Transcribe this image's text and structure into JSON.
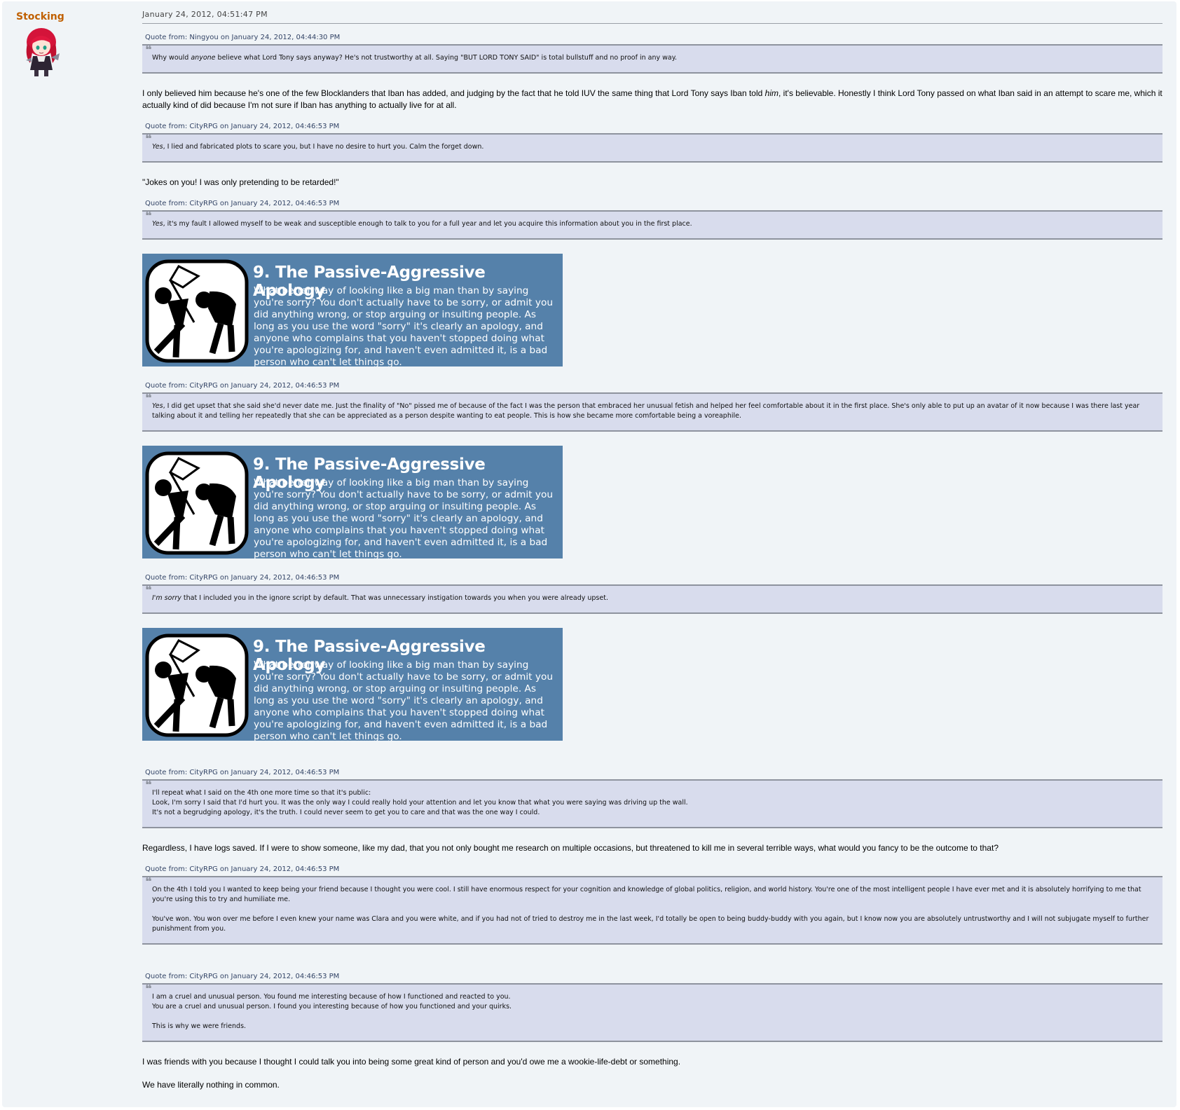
{
  "poster": {
    "name": "Stocking",
    "avatar_icon": "anime-girl-avatar-icon"
  },
  "post": {
    "date": "January 24, 2012, 04:51:47 PM"
  },
  "meme": {
    "icon": "kicking-stickfigure-icon",
    "title": "9. The Passive-Aggressive Apology",
    "body": "What better way of looking like a big man than by saying you're sorry?  You don't actually have to be sorry, or admit you did anything wrong, or stop arguing or insulting people.  As long as you use the word \"sorry\" it's clearly an apology, and anyone who complains that you haven't stopped doing what you're apologizing for, and haven't even admitted it, is a bad person who can't let things go."
  },
  "blocks": {
    "q1": {
      "header": "Quote from: Ningyou on January 24, 2012, 04:44:30 PM",
      "pre": "Why would ",
      "em": "anyone",
      "post": " believe what Lord Tony says anyway? He's not trustworthy at all. Saying \"BUT LORD TONY SAID\" is total bullstuff and no proof in any way."
    },
    "t1": {
      "pre": "I only believed him because he's one of the few Blocklanders that Iban has added, and judging by the fact that he told IUV the same thing that Lord Tony says Iban told ",
      "em": "him",
      "post": ", it's believable. Honestly I think Lord Tony passed on what Iban said in an attempt to scare me, which it actually kind of did because I'm not sure if Iban has anything to actually live for at all."
    },
    "q2": {
      "header": "Quote from: CityRPG on January 24, 2012, 04:46:53 PM",
      "em": "Yes",
      "post": ", I lied and fabricated plots to scare you, but I have no desire to hurt you. Calm the forget down."
    },
    "t2": "\"Jokes on you! I was only pretending to be retarded!\"",
    "q3": {
      "header": "Quote from: CityRPG on January 24, 2012, 04:46:53 PM",
      "em": "Yes",
      "post": ", it's my fault I allowed myself to be weak and susceptible enough to talk to you for a full year and let you acquire this information about you in the first place."
    },
    "q4": {
      "header": "Quote from: CityRPG on January 24, 2012, 04:46:53 PM",
      "em": "Yes",
      "post": ", I did get upset that she said she'd never date me. Just the finality of \"No\" pissed me of because of the fact I was the person that embraced her unusual fetish and helped her feel comfortable about it in the first place. She's only able to put up an avatar of it now because I was there last year talking about it and telling her repeatedly that she can be appreciated as a person despite wanting to eat people. This is how she became more comfortable being a voreaphile."
    },
    "q5": {
      "header": "Quote from: CityRPG on January 24, 2012, 04:46:53 PM",
      "em": "I'm sorry",
      "post": " that I included you in the ignore script by default. That was unnecessary instigation towards you when you were already upset."
    },
    "q6": {
      "header": "Quote from: CityRPG on January 24, 2012, 04:46:53 PM",
      "l1": "I'll repeat what I said on the 4th one more time so that it's public:",
      "l2": "Look, I'm sorry I said that I'd hurt you. It was the only way I could really hold your attention and let you know that what you were saying was driving up the wall.",
      "l3": "It's not a begrudging apology, it's the truth. I could never seem to get you to care and that was the one way I could."
    },
    "t3": "Regardless, I have logs saved. If I were to show someone, like my dad, that you not only bought me research on multiple occasions, but threatened to kill me in several terrible ways, what would you fancy to be the outcome to that?",
    "q7": {
      "header": "Quote from: CityRPG on January 24, 2012, 04:46:53 PM",
      "p1": "On the 4th I told you I wanted to keep being your friend because I thought you were cool. I still have enormous respect for your cognition and knowledge of global politics, religion, and world history. You're one of the most intelligent people I have ever met and it is absolutely horrifying to me that you're using this to try and humiliate me.",
      "p2": "You've won. You won over me before I even knew your name was Clara and you were white, and if you had not of tried to destroy me in the last week, I'd totally be open to being buddy-buddy with you again, but I know now you are absolutely untrustworthy and I will not subjugate myself to further punishment from you."
    },
    "q8": {
      "header": "Quote from: CityRPG on January 24, 2012, 04:46:53 PM",
      "l1": "I am a cruel and unusual person. You found me interesting because of how I functioned and reacted to you.",
      "l2": "You are a cruel and unusual person. I found you interesting because of how you functioned and your quirks.",
      "l3": "This is why we were friends."
    },
    "t4": "I was friends with you because I thought I could talk you into being some great kind of person and you'd owe me a wookie-life-debt or something.",
    "t5": "We have literally nothing in common."
  }
}
